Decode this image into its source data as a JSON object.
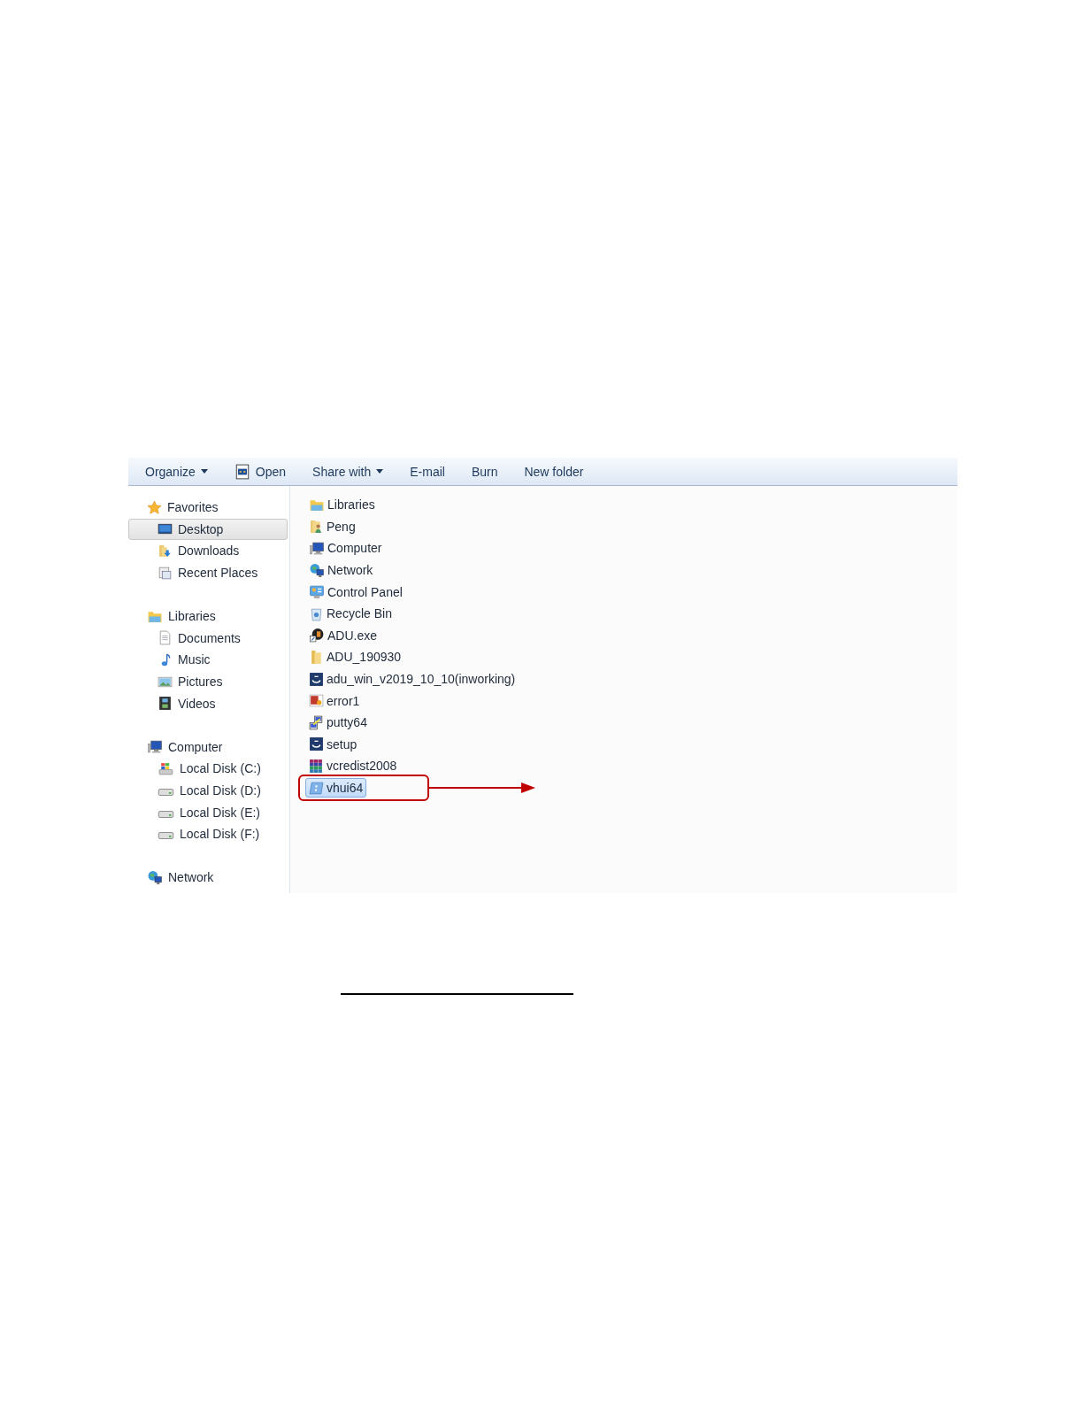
{
  "toolbar": [
    {
      "label": "Organize",
      "kind": "menu"
    },
    {
      "label": "Open",
      "kind": "icon"
    },
    {
      "label": "Share with",
      "kind": "menu"
    },
    {
      "label": "E-mail",
      "kind": "plain"
    },
    {
      "label": "Burn",
      "kind": "plain"
    },
    {
      "label": "New folder",
      "kind": "plain"
    }
  ],
  "navigation": [
    {
      "label": "Favorites",
      "selected": false,
      "children": [
        {
          "label": "Desktop",
          "selected": true
        },
        {
          "label": "Downloads",
          "selected": false
        },
        {
          "label": "Recent Places",
          "selected": false
        }
      ]
    },
    {
      "label": "Libraries",
      "selected": false,
      "children": [
        {
          "label": "Documents",
          "selected": false
        },
        {
          "label": "Music",
          "selected": false
        },
        {
          "label": "Pictures",
          "selected": false
        },
        {
          "label": "Videos",
          "selected": false
        }
      ]
    },
    {
      "label": "Computer",
      "selected": false,
      "children": [
        {
          "label": "Local Disk (C:)",
          "selected": false
        },
        {
          "label": "Local Disk (D:)",
          "selected": false
        },
        {
          "label": "Local Disk (E:)",
          "selected": false
        },
        {
          "label": "Local Disk (F:)",
          "selected": false
        }
      ]
    },
    {
      "label": "Network",
      "selected": false
    }
  ],
  "files": [
    {
      "name": "Libraries",
      "selected": false
    },
    {
      "name": "Peng",
      "selected": false
    },
    {
      "name": "Computer",
      "selected": false
    },
    {
      "name": "Network",
      "selected": false
    },
    {
      "name": "Control Panel",
      "selected": false
    },
    {
      "name": "Recycle Bin",
      "selected": false
    },
    {
      "name": "ADU.exe",
      "selected": false
    },
    {
      "name": "ADU_190930",
      "selected": false
    },
    {
      "name": "adu_win_v2019_10_10(inworking)",
      "selected": false
    },
    {
      "name": "error1",
      "selected": false
    },
    {
      "name": "putty64",
      "selected": false
    },
    {
      "name": "setup",
      "selected": false
    },
    {
      "name": "vcredist2008",
      "selected": false
    },
    {
      "name": "vhui64",
      "selected": true
    }
  ]
}
